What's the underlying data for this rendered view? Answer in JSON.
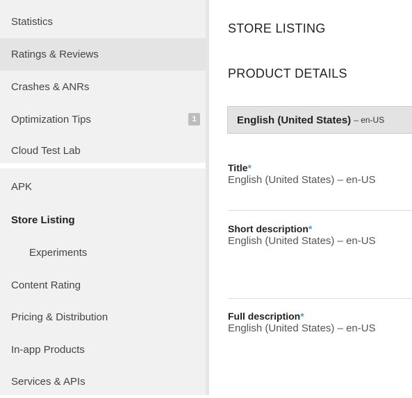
{
  "sidebar": {
    "items": [
      {
        "label": "Statistics"
      },
      {
        "label": "Ratings & Reviews"
      },
      {
        "label": "Crashes & ANRs"
      },
      {
        "label": "Optimization Tips",
        "badge": "1"
      },
      {
        "label": "Cloud Test Lab"
      },
      {
        "label": "APK"
      },
      {
        "label": "Store Listing"
      },
      {
        "label": "Experiments"
      },
      {
        "label": "Content Rating"
      },
      {
        "label": "Pricing & Distribution"
      },
      {
        "label": "In-app Products"
      },
      {
        "label": "Services & APIs"
      }
    ]
  },
  "main": {
    "page_title": "STORE LISTING",
    "section_title": "PRODUCT DETAILS",
    "language_tab": {
      "name": "English (United States)",
      "code": "– en-US"
    },
    "fields": [
      {
        "label": "Title",
        "required": "*",
        "language": "English (United States) – en-US"
      },
      {
        "label": "Short description",
        "required": "*",
        "language": "English (United States) – en-US"
      },
      {
        "label": "Full description",
        "required": "*",
        "language": "English (United States) – en-US"
      }
    ]
  }
}
